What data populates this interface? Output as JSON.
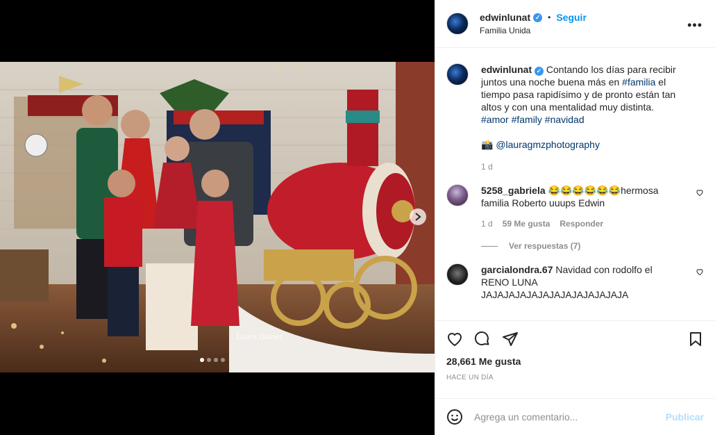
{
  "post": {
    "username": "edwinlunat",
    "follow_label": "Seguir",
    "separator": "•",
    "location": "Familia Unida",
    "more": "•••"
  },
  "caption": {
    "username": "edwinlunat",
    "text_1": "Contando los días para recibir juntos una noche buena más en ",
    "hashtag_1": "#familia",
    "text_2": " el tiempo pasa rapidísimo y de pronto están tan altos y con una mentalidad muy distinta.",
    "hashtags": "#amor #family #navidad",
    "camera": "📸",
    "credit": "@lauragmzphotography",
    "time": "1 d"
  },
  "comments": [
    {
      "username": "5258_gabriela",
      "text": "😂😂😂😂😂😂hermosa familia Roberto uuups Edwin",
      "time": "1 d",
      "likes": "59 Me gusta",
      "reply": "Responder"
    },
    {
      "username": "garcialondra.67",
      "text": "Navidad con rodolfo el RENO LUNA JAJAJAJAJAJAJAJAJAJAJAJAJA"
    }
  ],
  "view_replies": "Ver respuestas (7)",
  "likes_count": "28,661 Me gusta",
  "posted_ago": "HACE UN DÍA",
  "comment_box": {
    "placeholder": "Agrega un comentario...",
    "publish": "Publicar"
  },
  "photo": {
    "watermark": "Laura Gomez",
    "slide_count": 4,
    "active_slide": 1
  },
  "colors": {
    "link": "#0095f6",
    "hashtag": "#00376b",
    "muted": "#8e8e8e",
    "verified": "#3897f0"
  }
}
